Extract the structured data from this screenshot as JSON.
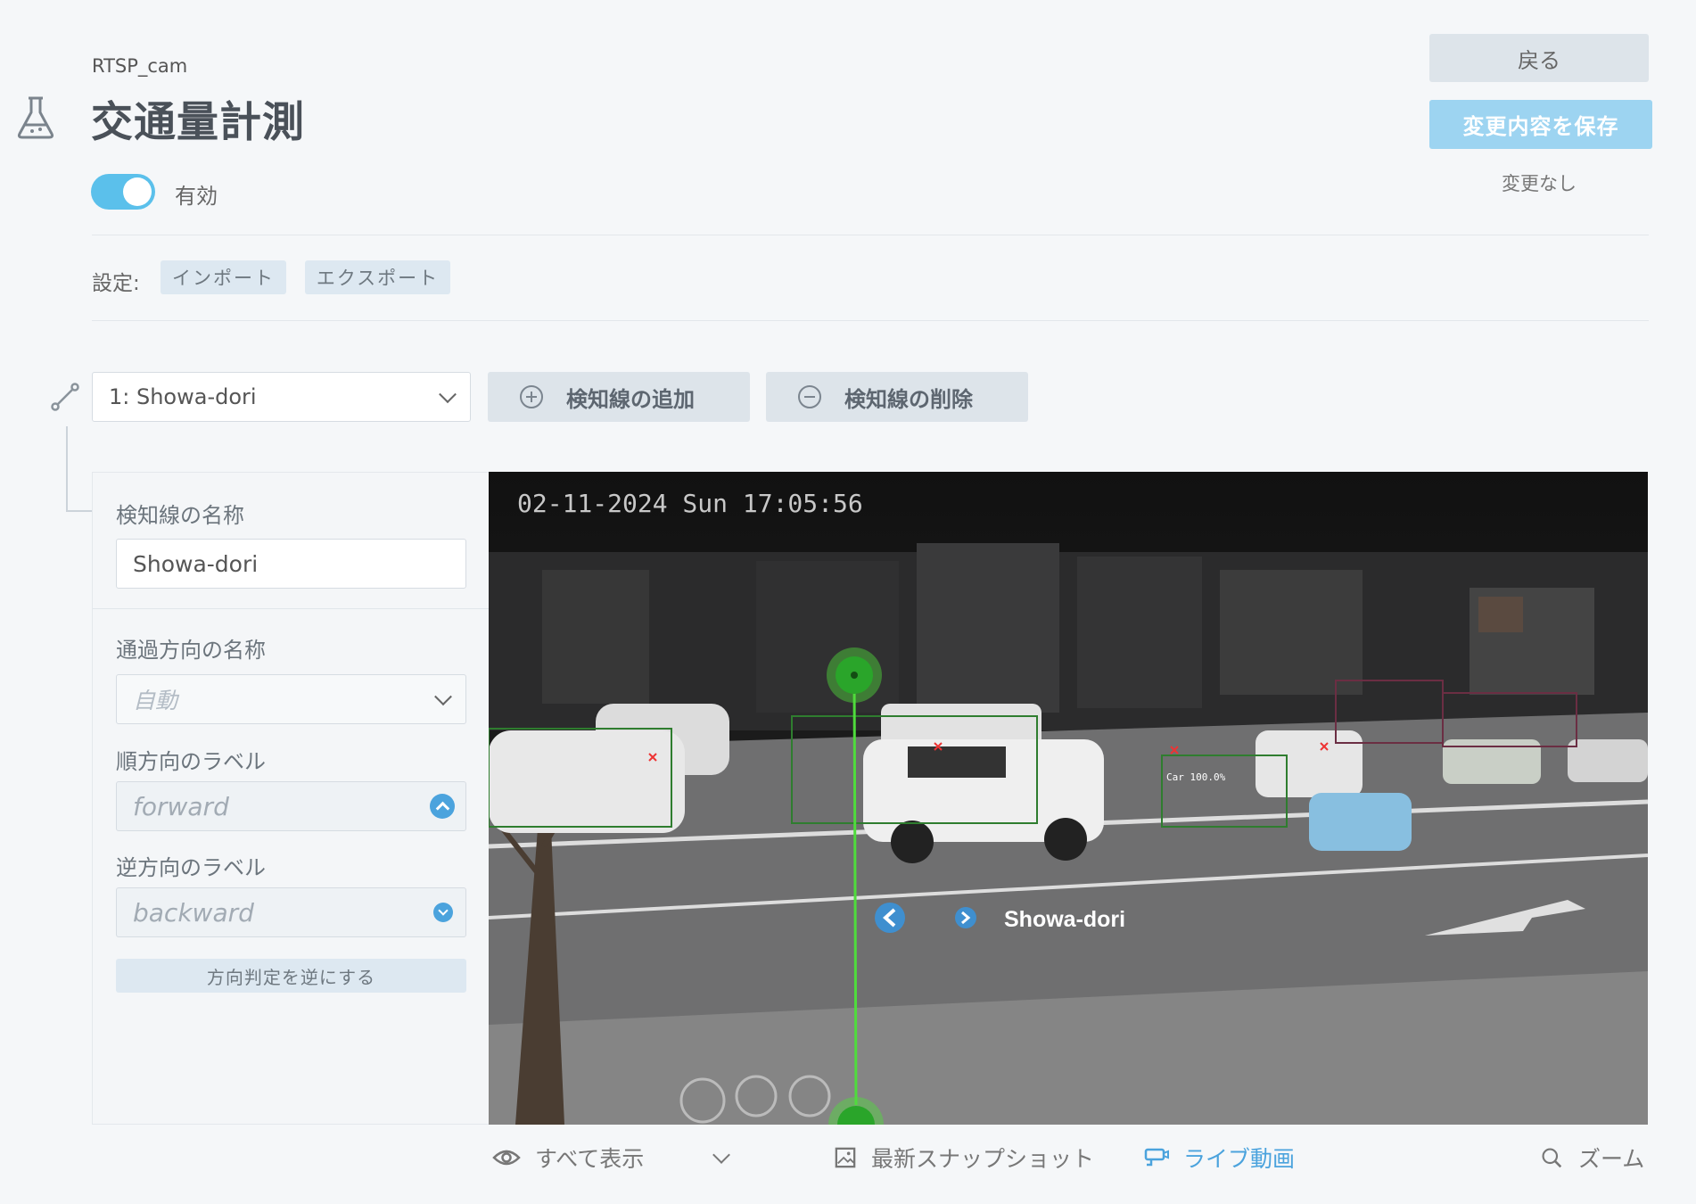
{
  "header": {
    "subtitle": "RTSP_cam",
    "title": "交通量計測",
    "enabled_label": "有効",
    "back_label": "戻る",
    "save_label": "変更内容を保存",
    "status_text": "変更なし"
  },
  "settings": {
    "label": "設定:",
    "import_label": "インポート",
    "export_label": "エクスポート"
  },
  "toolbar": {
    "line_selected": "1: Showa-dori",
    "add_label": "検知線の追加",
    "delete_label": "検知線の削除"
  },
  "panel": {
    "name_label": "検知線の名称",
    "name_value": "Showa-dori",
    "direction_name_label": "通過方向の名称",
    "direction_name_placeholder": "自動",
    "forward_label_label": "順方向のラベル",
    "forward_value": "forward",
    "backward_label_label": "逆方向のラベル",
    "backward_value": "backward",
    "reverse_label": "方向判定を逆にする"
  },
  "video": {
    "timestamp": "02-11-2024 Sun 17:05:56",
    "line_label": "Showa-dori",
    "detection_label": "Car 100.0%"
  },
  "bottom": {
    "show_all": "すべて表示",
    "snapshot": "最新スナップショット",
    "live": "ライブ動画",
    "zoom": "ズーム"
  },
  "colors": {
    "accent": "#4ba3dd",
    "toggle": "#5bc0eb",
    "detection_line": "#4fdc3c"
  }
}
